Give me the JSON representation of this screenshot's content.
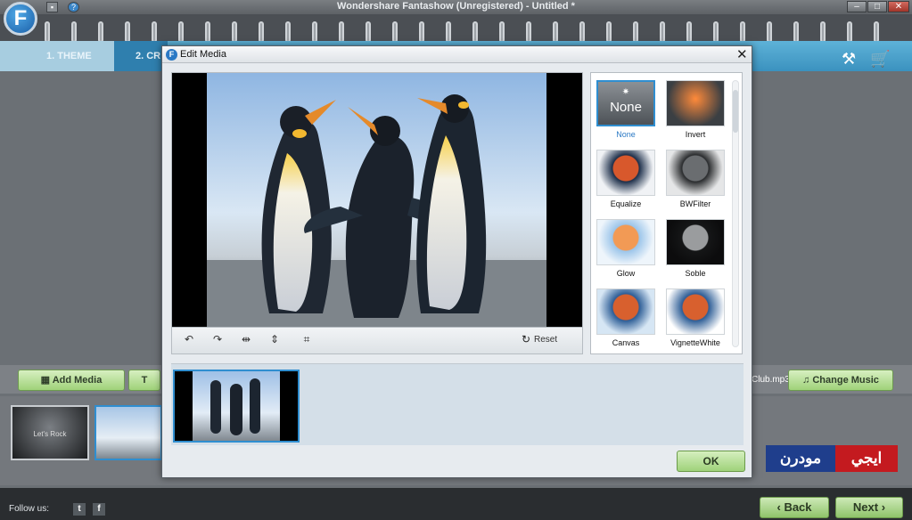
{
  "window": {
    "title": "Wondershare Fantashow (Unregistered) - Untitled *",
    "logo": "F"
  },
  "steps": [
    {
      "label": "1. THEME"
    },
    {
      "label": "2. CR"
    }
  ],
  "toolbar": {
    "add_media": "Add Media",
    "text_btn": "T",
    "music_file": "Club.mp3",
    "change_music": "Change Music"
  },
  "timeline": {
    "item1": "Let's Rock"
  },
  "footer": {
    "follow": "Follow us:",
    "back": "Back",
    "next": "Next"
  },
  "dialog": {
    "title": "Edit Media",
    "icon_letter": "F",
    "reset": "Reset",
    "ok": "OK",
    "effects": [
      {
        "label": "None",
        "selected": true,
        "tile_text": "None"
      },
      {
        "label": "Invert"
      },
      {
        "label": "Equalize"
      },
      {
        "label": "BWFilter"
      },
      {
        "label": "Glow"
      },
      {
        "label": "Soble"
      },
      {
        "label": "Canvas"
      },
      {
        "label": "VignetteWhite"
      }
    ]
  },
  "watermark": {
    "part1": "ايجي",
    "part2": "مودرن"
  },
  "colors": {
    "accent_blue": "#2f8ed0",
    "green_button": "#9fd27a",
    "step_bar": "#3b92bf"
  }
}
